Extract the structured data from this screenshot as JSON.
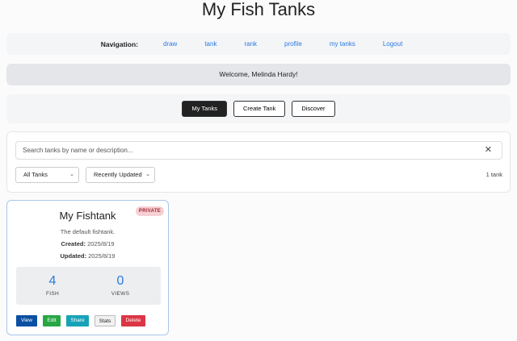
{
  "title": "My Fish Tanks",
  "nav": {
    "label": "Navigation:",
    "links": [
      "draw",
      "tank",
      "rank",
      "profile",
      "my tanks",
      "Logout"
    ]
  },
  "welcome": "Welcome, Melinda Hardy!",
  "tabs": [
    "My Tanks",
    "Create Tank",
    "Discover"
  ],
  "active_tab": "My Tanks",
  "filters": {
    "search_placeholder": "Search tanks by name or description...",
    "type": "All Tanks",
    "sort": "Recently Updated",
    "count": "1 tank"
  },
  "card": {
    "title": "My Fishtank",
    "badge": "PRIVATE",
    "description": "The default fishtank.",
    "created_label": "Created:",
    "created": "2025/8/19",
    "updated_label": "Updated:",
    "updated": "2025/8/19",
    "fish": "4",
    "fish_label": "FISH",
    "views": "0",
    "views_label": "VIEWS",
    "buttons": [
      "View",
      "Edit",
      "Share",
      "Stats",
      "Delete"
    ]
  },
  "colors": {
    "link": "#2a7ae2",
    "view": "#0b4fa3",
    "edit": "#28a745",
    "share": "#17a2b8",
    "delete": "#dc3545"
  }
}
